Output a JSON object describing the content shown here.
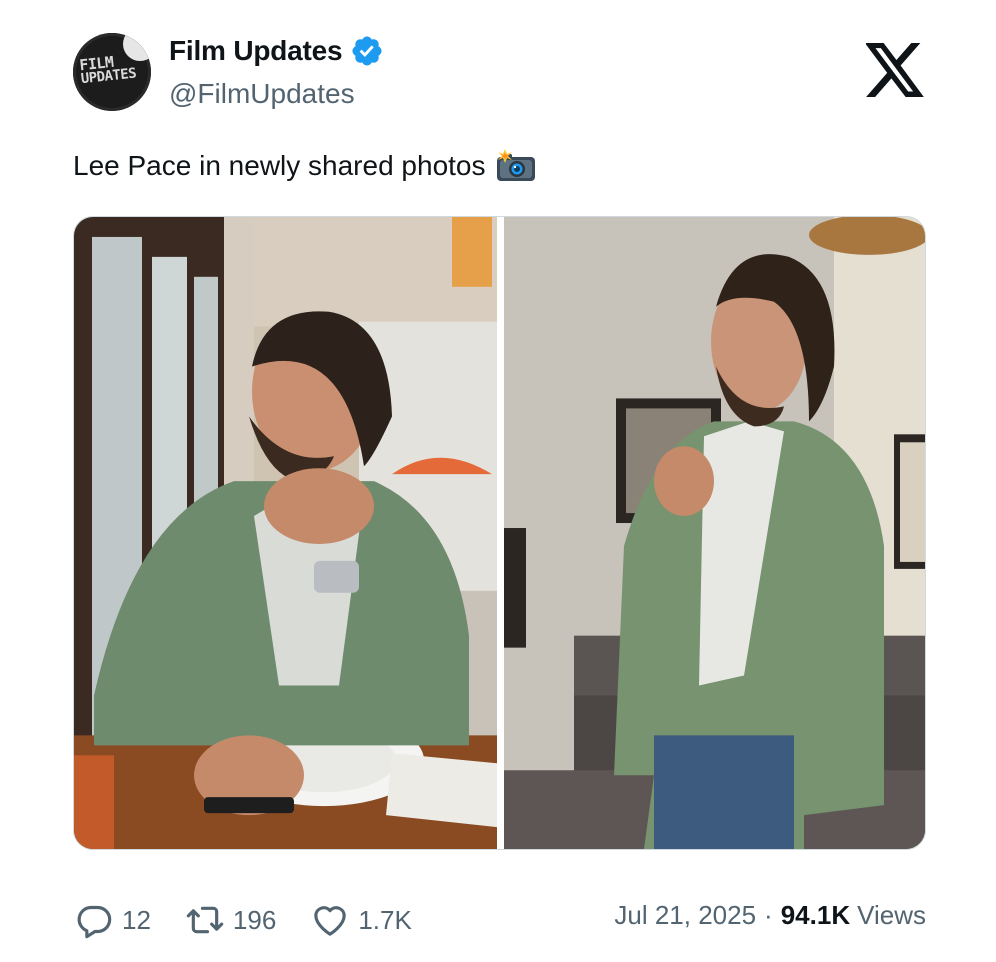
{
  "author": {
    "display_name": "Film Updates",
    "handle": "@FilmUpdates",
    "avatar_text_line1": "FILM",
    "avatar_text_line2": "UPDATES",
    "verified": true
  },
  "tweet": {
    "text": "Lee Pace in newly shared photos",
    "emoji": "camera-with-flash-icon",
    "media_count": 2
  },
  "engagement": {
    "replies": "12",
    "reposts": "196",
    "likes": "1.7K"
  },
  "meta": {
    "date": "Jul 21, 2025",
    "separator": "·",
    "views_count": "94.1K",
    "views_label": "Views"
  },
  "colors": {
    "text_primary": "#0f1419",
    "text_secondary": "#536471",
    "verified_blue": "#1d9bf0",
    "border": "#cfd9de"
  }
}
